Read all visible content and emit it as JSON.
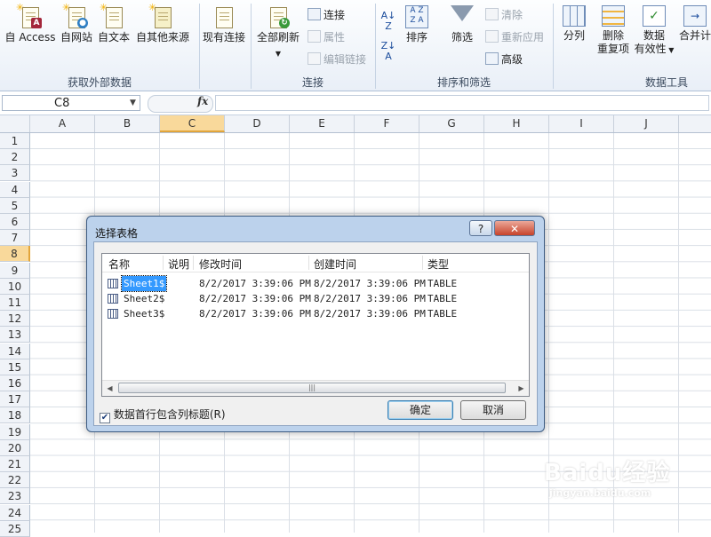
{
  "ribbon": {
    "groups": {
      "external_data": {
        "label": "获取外部数据",
        "access": "自 Access",
        "web": "自网站",
        "text": "自文本",
        "other": "自其他来源",
        "existing": "现有连接"
      },
      "connections": {
        "label": "连接",
        "refresh_all": "全部刷新",
        "connections": "连接",
        "properties": "属性",
        "edit_links": "编辑链接"
      },
      "sort_filter": {
        "label": "排序和筛选",
        "sort": "排序",
        "filter": "筛选",
        "clear": "清除",
        "reapply": "重新应用",
        "advanced": "高级"
      },
      "data_tools": {
        "label": "数据工具",
        "text_to_columns": "分列",
        "remove_dup_1": "删除",
        "remove_dup_2": "重复项",
        "validation_1": "数据",
        "validation_2": "有效性",
        "consolidate": "合并计"
      }
    }
  },
  "formula_bar": {
    "name_box": "C8",
    "fx": "fx"
  },
  "grid": {
    "columns": [
      "A",
      "B",
      "C",
      "D",
      "E",
      "F",
      "G",
      "H",
      "I",
      "J"
    ],
    "rows": [
      "1",
      "2",
      "3",
      "4",
      "5",
      "6",
      "7",
      "8",
      "9",
      "10",
      "11",
      "12",
      "13",
      "14",
      "15",
      "16",
      "17",
      "18",
      "19",
      "20",
      "21",
      "22",
      "23",
      "24",
      "25"
    ],
    "active_cell": "C8"
  },
  "dialog": {
    "title": "选择表格",
    "help": "?",
    "close": "✕",
    "headers": [
      "名称",
      "说明",
      "修改时间",
      "创建时间",
      "类型"
    ],
    "rows": [
      {
        "name": "Sheet1$",
        "modified": "8/2/2017  3:39:06 PM",
        "created": "8/2/2017  3:39:06 PM",
        "type": "TABLE"
      },
      {
        "name": "Sheet2$",
        "modified": "8/2/2017  3:39:06 PM",
        "created": "8/2/2017  3:39:06 PM",
        "type": "TABLE"
      },
      {
        "name": "Sheet3$",
        "modified": "8/2/2017  3:39:06 PM",
        "created": "8/2/2017  3:39:06 PM",
        "type": "TABLE"
      }
    ],
    "checkbox_label": "数据首行包含列标题(R)",
    "checkbox_checked": true,
    "ok": "确定",
    "cancel": "取消"
  },
  "watermark": {
    "main": "Baidu经验",
    "sub": "jingyan.baidu.com"
  }
}
